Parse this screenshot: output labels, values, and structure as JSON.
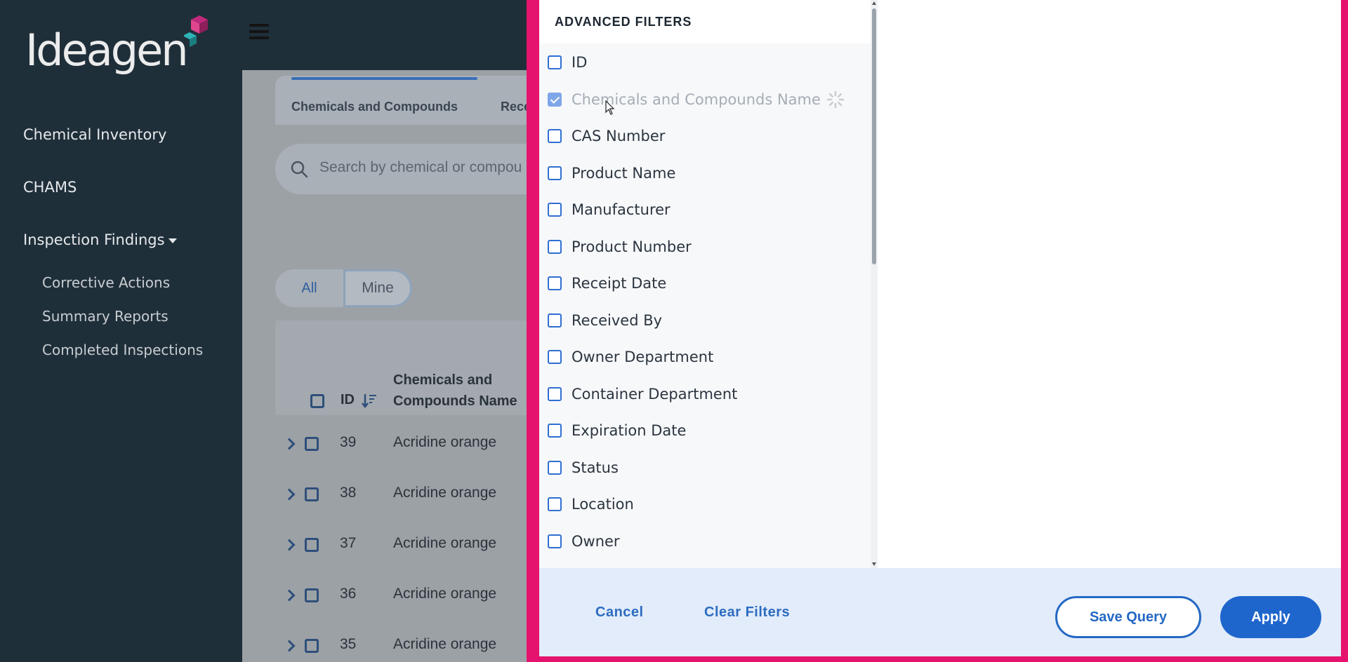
{
  "sidebar": {
    "brand": "Ideagen",
    "items": [
      {
        "label": "Chemical Inventory"
      },
      {
        "label": "CHAMS"
      },
      {
        "label": "Inspection Findings"
      }
    ],
    "sub_items": [
      {
        "label": "Corrective Actions"
      },
      {
        "label": "Summary Reports"
      },
      {
        "label": "Completed Inspections"
      }
    ]
  },
  "background": {
    "tabs": [
      {
        "label": "Chemicals and Compounds"
      },
      {
        "label": "Recei"
      }
    ],
    "search_placeholder": "Search by chemical or compou",
    "toggle": {
      "all": "All",
      "mine": "Mine"
    },
    "table": {
      "col_id": "ID",
      "col_name": "Chemicals and Compounds Name",
      "rows": [
        {
          "id": "39",
          "name": "Acridine orange"
        },
        {
          "id": "38",
          "name": "Acridine orange"
        },
        {
          "id": "37",
          "name": "Acridine orange"
        },
        {
          "id": "36",
          "name": "Acridine orange"
        },
        {
          "id": "35",
          "name": "Acridine orange"
        }
      ]
    }
  },
  "modal": {
    "title": "ADVANCED FILTERS",
    "filters": [
      {
        "label": "ID",
        "checked": false
      },
      {
        "label": "Chemicals and Compounds Name",
        "checked": true,
        "loading": true
      },
      {
        "label": "CAS Number",
        "checked": false
      },
      {
        "label": "Product Name",
        "checked": false
      },
      {
        "label": "Manufacturer",
        "checked": false
      },
      {
        "label": "Product Number",
        "checked": false
      },
      {
        "label": "Receipt Date",
        "checked": false
      },
      {
        "label": "Received By",
        "checked": false
      },
      {
        "label": "Owner Department",
        "checked": false
      },
      {
        "label": "Container Department",
        "checked": false
      },
      {
        "label": "Expiration Date",
        "checked": false
      },
      {
        "label": "Status",
        "checked": false
      },
      {
        "label": "Location",
        "checked": false
      },
      {
        "label": "Owner",
        "checked": false
      }
    ],
    "footer": {
      "cancel": "Cancel",
      "clear": "Clear Filters",
      "save_query": "Save Query",
      "apply": "Apply"
    }
  },
  "colors": {
    "sidebar_bg": "#1f2f3a",
    "modal_border": "#e5136d",
    "primary": "#1f66cc",
    "footer_bg": "#e2ecfa"
  }
}
